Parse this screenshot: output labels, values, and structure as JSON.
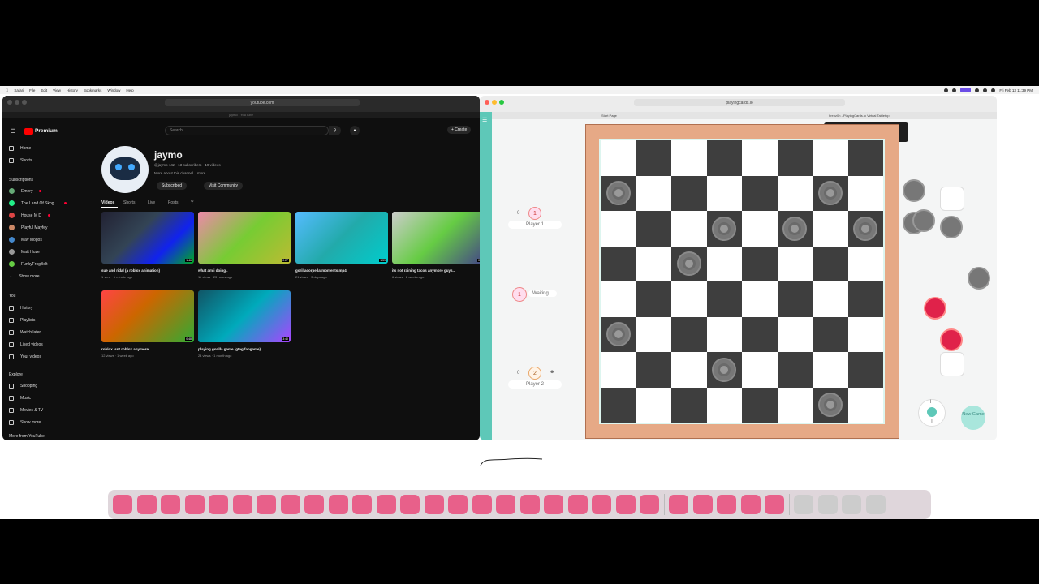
{
  "menubar": {
    "items": [
      "Safari",
      "File",
      "Edit",
      "View",
      "History",
      "Bookmarks",
      "Window",
      "Help"
    ],
    "clock": "Fri Feb 13 11:39 PM"
  },
  "youtube": {
    "url": "youtube.com",
    "tab_subtitle": "jaymo - YouTube",
    "brand": "Premium",
    "search_placeholder": "Search",
    "create_label": "+ Create",
    "nav": [
      {
        "label": "Home"
      },
      {
        "label": "Shorts"
      }
    ],
    "subs_header": "Subscriptions",
    "subscriptions": [
      "Emery",
      "The Land Of Skog...",
      "House M D",
      "Playful Mayfey",
      "Mav Mogos",
      "Matt Hoze",
      "FunkyFrogBolt"
    ],
    "show_more": "Show more",
    "you_header": "You",
    "you_items": [
      "History",
      "Playlists",
      "Watch later",
      "Liked videos",
      "Your videos"
    ],
    "explore_header": "Explore",
    "explore_items": [
      "Shopping",
      "Music",
      "Movies & TV",
      "Show more"
    ],
    "more_from": "More from YouTube",
    "channel": {
      "name": "jaymo",
      "handle_line": "@jaymo-s4z · 13 subscribers · 19 videos",
      "about": "More about this channel ...more",
      "subscribed": "Subscribed",
      "visit": "Visit Community"
    },
    "tabs": [
      "Videos",
      "Shorts",
      "Live",
      "Posts"
    ],
    "videos": [
      {
        "title": "sue and ridal (a roblox animation)",
        "meta": "1 view · 1 minute ago",
        "duration": "1:46"
      },
      {
        "title": "what am i doing..",
        "meta": "11 views · 23 hours ago",
        "duration": "0:27"
      },
      {
        "title": "gorillacorpellatmoments.mp4",
        "meta": "21 views · 3 days ago",
        "duration": "1:59"
      },
      {
        "title": "its not raining tacos anymore guys...",
        "meta": "6 views · 2 weeks ago",
        "duration": "0:2"
      },
      {
        "title": "roblox isnt roblox anymore...",
        "meta": "12 views · 1 week ago",
        "duration": "0:48"
      },
      {
        "title": "playing gorilla game (gtag fangame)",
        "meta": "24 views · 1 month ago",
        "duration": "3:40"
      }
    ]
  },
  "playingcards": {
    "url": "playingcards.io",
    "tab_start": "Start Page",
    "tab_active": "hrenz0n - PlayingCards.io Virtual Tabletop",
    "tooltip_title": "hrenz0n - PlayingCards.io Virtual Tabletop",
    "tooltip_url": "playingcards.io",
    "player1": {
      "label": "Player 1",
      "score": "0",
      "seat": "1"
    },
    "waiting": {
      "seat": "1",
      "label": "Waiting..."
    },
    "player2": {
      "label": "Player 2",
      "score": "0",
      "seat": "2"
    },
    "new_game": "New Game",
    "hide_h": "H",
    "hide_t": "T"
  },
  "board_pieces": [
    [
      1,
      0
    ],
    [
      1,
      6
    ],
    [
      2,
      3
    ],
    [
      2,
      5
    ],
    [
      2,
      7
    ],
    [
      3,
      2
    ],
    [
      5,
      0
    ],
    [
      6,
      3
    ],
    [
      7,
      6
    ]
  ]
}
